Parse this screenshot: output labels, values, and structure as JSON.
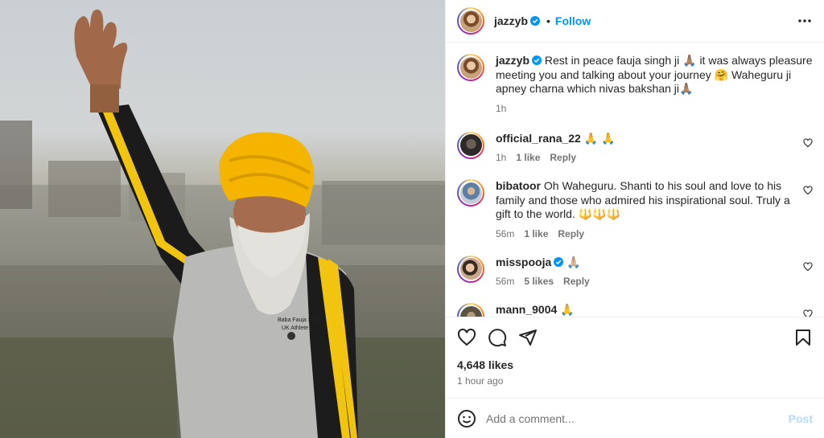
{
  "post": {
    "username": "jazzyb",
    "follow_label": "Follow",
    "dot": "•",
    "likes": "4,648 likes",
    "posted_time": "1 hour ago"
  },
  "caption": {
    "username": "jazzyb",
    "text": "Rest in peace fauja singh ji 🙏🏽 it was always pleasure meeting you and talking about your journey 🤗 Waheguru ji apney charna which nivas bakshan ji🙏🏽",
    "time": "1h"
  },
  "comments": [
    {
      "username": "official_rana_22",
      "text": "🙏 🙏",
      "time": "1h",
      "likes": "1 like",
      "reply": "Reply"
    },
    {
      "username": "bibatoor",
      "text": "Oh Waheguru. Shanti to his soul and love to his family and those who admired his inspirational soul. Truly a gift to the world. 🔱🔱🔱",
      "time": "56m",
      "likes": "1 like",
      "reply": "Reply"
    },
    {
      "username": "misspooja",
      "text": "🙏🏼",
      "time": "56m",
      "likes": "5 likes",
      "reply": "Reply",
      "verified": true
    },
    {
      "username": "mann_9004",
      "text": "🙏"
    }
  ],
  "add_comment": {
    "placeholder": "Add a comment...",
    "post_label": "Post"
  },
  "photo": {
    "jersey_text_line1": "Baba Fauja Singh",
    "jersey_text_line2": "UK Athlete"
  },
  "colors": {
    "accent": "#0095f6",
    "turban": "#f4b400",
    "post_disabled": "#b3dbff"
  }
}
